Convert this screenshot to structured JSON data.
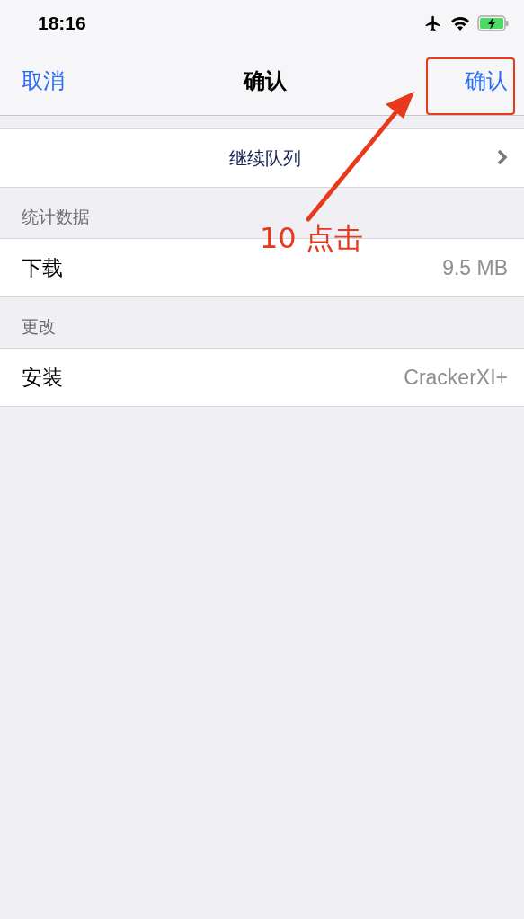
{
  "status_bar": {
    "time": "18:16"
  },
  "nav": {
    "cancel": "取消",
    "title": "确认",
    "confirm": "确认"
  },
  "action_row": {
    "label": "继续队列"
  },
  "sections": [
    {
      "header": "统计数据",
      "rows": [
        {
          "label": "下载",
          "value": "9.5 MB"
        }
      ]
    },
    {
      "header": "更改",
      "rows": [
        {
          "label": "安装",
          "value": "CrackerXI+"
        }
      ]
    }
  ],
  "annotation": {
    "label": "10 点击"
  }
}
